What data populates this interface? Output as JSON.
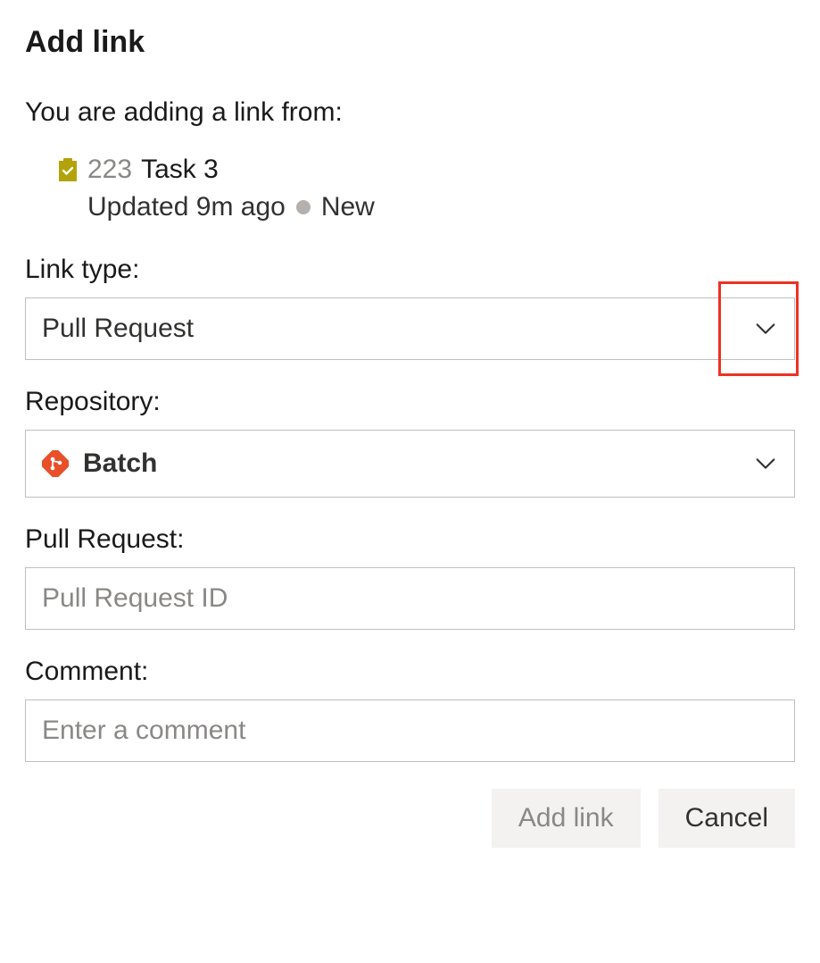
{
  "dialog": {
    "title": "Add link",
    "subtitle": "You are adding a link from:"
  },
  "workitem": {
    "id": "223",
    "title": "Task 3",
    "updated_text": "Updated 9m ago",
    "state": "New"
  },
  "fields": {
    "link_type": {
      "label": "Link type:",
      "value": "Pull Request"
    },
    "repository": {
      "label": "Repository:",
      "value": "Batch"
    },
    "pull_request": {
      "label": "Pull Request:",
      "placeholder": "Pull Request ID"
    },
    "comment": {
      "label": "Comment:",
      "placeholder": "Enter a comment"
    }
  },
  "buttons": {
    "add": "Add link",
    "cancel": "Cancel"
  }
}
